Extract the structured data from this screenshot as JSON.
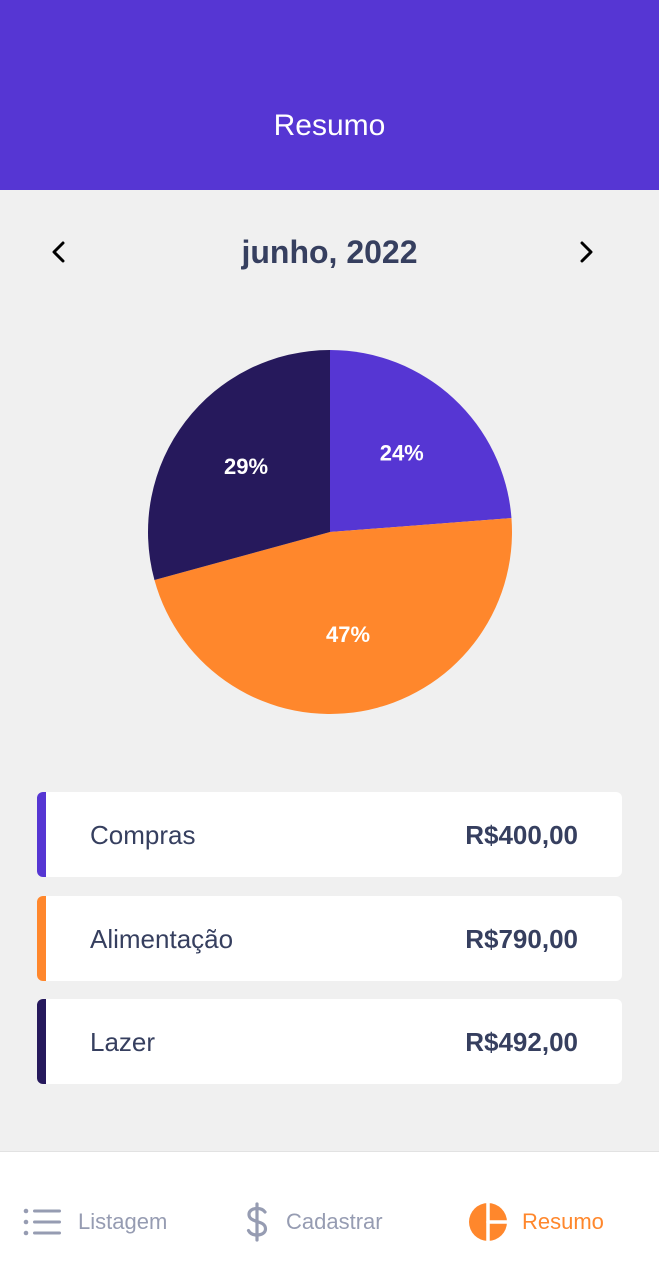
{
  "header": {
    "title": "Resumo",
    "color": "#5636d3"
  },
  "month_selector": {
    "label": "junho, 2022",
    "prev_icon": "chevron-left-icon",
    "next_icon": "chevron-right-icon"
  },
  "chart_data": {
    "type": "pie",
    "categories": [
      "Compras",
      "Alimentação",
      "Lazer"
    ],
    "values": [
      400,
      790,
      492
    ],
    "labels": [
      "24%",
      "47%",
      "29%"
    ],
    "colors": [
      "#5636d3",
      "#ff872c",
      "#26195c"
    ]
  },
  "categories": [
    {
      "name": "Compras",
      "amount": "R$400,00",
      "color": "#5636d3"
    },
    {
      "name": "Alimentação",
      "amount": "R$790,00",
      "color": "#ff872c"
    },
    {
      "name": "Lazer",
      "amount": "R$492,00",
      "color": "#26195c"
    }
  ],
  "tabs": [
    {
      "label": "Listagem",
      "icon": "list-icon",
      "active": false
    },
    {
      "label": "Cadastrar",
      "icon": "dollar-sign-icon",
      "active": false
    },
    {
      "label": "Resumo",
      "icon": "pie-chart-icon",
      "active": true
    }
  ],
  "colors": {
    "active_tab": "#ff872c",
    "inactive_tab": "#969cb2",
    "text": "#363f5f"
  }
}
